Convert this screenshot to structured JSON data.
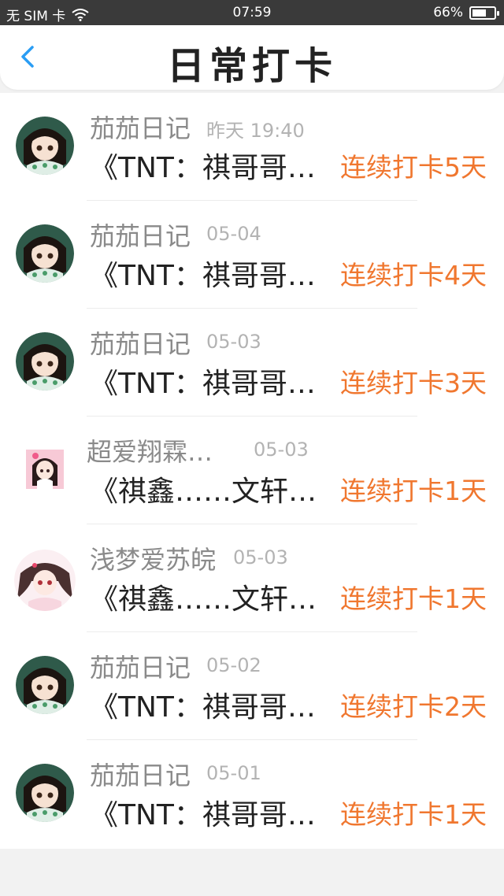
{
  "status_bar": {
    "left_text": "无 SIM 卡",
    "time": "07:59",
    "battery": "66%",
    "battery_level": 0.66
  },
  "header": {
    "title": "日常打卡"
  },
  "items": [
    {
      "user": "茄茄日记",
      "time": "昨天 19:40",
      "title": "《TNT：祺哥哥…",
      "streak": "连续打卡5天"
    },
    {
      "user": "茄茄日记",
      "time": "05-04",
      "title": "《TNT：祺哥哥…",
      "streak": "连续打卡4天"
    },
    {
      "user": "茄茄日记",
      "time": "05-03",
      "title": "《TNT：祺哥哥…",
      "streak": "连续打卡3天"
    },
    {
      "user": "超爱翔霖…",
      "time": "05-03",
      "title": "《祺鑫……文轩…",
      "streak": "连续打卡1天"
    },
    {
      "user": "浅梦爱苏皖",
      "time": "05-03",
      "title": "《祺鑫……文轩…",
      "streak": "连续打卡1天"
    },
    {
      "user": "茄茄日记",
      "time": "05-02",
      "title": "《TNT：祺哥哥…",
      "streak": "连续打卡2天"
    },
    {
      "user": "茄茄日记",
      "time": "05-01",
      "title": "《TNT：祺哥哥…",
      "streak": "连续打卡1天"
    }
  ],
  "colors": {
    "accent_back": "#2a9df4",
    "streak": "#f0772f",
    "status_bar_bg": "#3a3a3a"
  },
  "icons": {
    "back": "chevron-left-icon",
    "wifi": "wifi-icon",
    "battery": "battery-icon"
  }
}
